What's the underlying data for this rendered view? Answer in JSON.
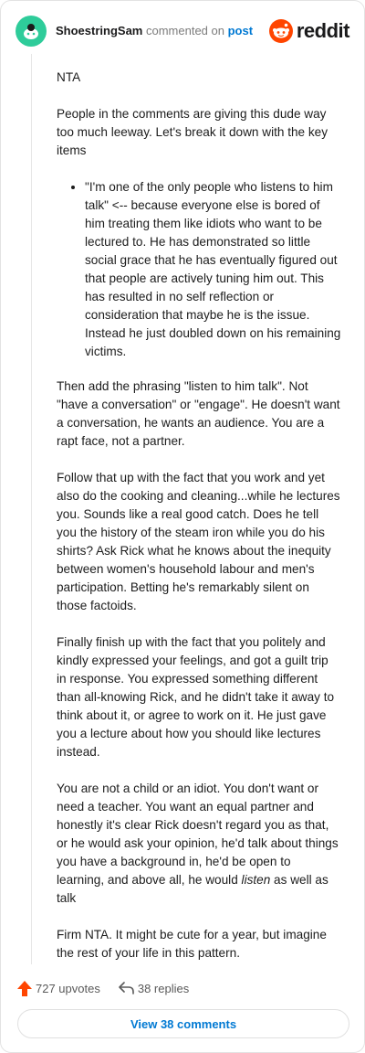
{
  "comment": {
    "username": "ShoestringSam",
    "commented_on_text": "commented on",
    "post_link_text": "post",
    "brand": "reddit",
    "opening": "NTA",
    "para1": "People in the comments are giving this dude way too much leeway. Let's break it down with the key items",
    "bullet1": "\"I'm one of the only people who listens to him talk\" <-- because everyone else is bored of him treating them like idiots who want to be lectured to. He has demonstrated so little social grace that he has eventually figured out that people are actively tuning him out. This has resulted in no self reflection or consideration that maybe he is the issue. Instead he just doubled down on his remaining victims.",
    "para2": "Then add the phrasing \"listen to him talk\". Not \"have a conversation\" or \"engage\". He doesn't want a conversation, he wants an audience. You are a rapt face, not a partner.",
    "para3": "Follow that up with the fact that you work and yet also do the cooking and cleaning...while he lectures you. Sounds like a real good catch. Does he tell you the history of the steam iron while you do his shirts? Ask Rick what he knows about the inequity between women's household labour and men's participation. Betting he's remarkably silent on those factoids.",
    "para4": "Finally finish up with the fact that you politely and kindly expressed your feelings, and got a guilt trip in response. You expressed something different than all-knowing Rick, and he didn't take it away to think about it, or agree to work on it. He just gave you a lecture about how you should like lectures instead.",
    "para5_before": "You are not a child or an idiot. You don't want or need a teacher. You want an equal partner and honestly it's clear Rick doesn't regard you as that, or he would ask your opinion, he'd talk about things you have a background in, he'd be open to learning, and above all, he would ",
    "para5_emphasis": "listen",
    "para5_after": " as well as talk",
    "para6": "Firm NTA. It might be cute for a year, but imagine the rest of your life in this pattern."
  },
  "footer": {
    "upvotes": "727 upvotes",
    "replies": "38 replies",
    "view_button": "View 38 comments"
  },
  "colors": {
    "avatar": "#2ecc9a",
    "reddit_orange": "#ff4500",
    "upvote": "#ff4500",
    "link_blue": "#0079d3"
  },
  "icons": {
    "avatar": "snoo-avatar-icon",
    "brand": "reddit-logo-icon",
    "upvote": "upvote-arrow-icon",
    "reply": "reply-arrow-icon"
  }
}
